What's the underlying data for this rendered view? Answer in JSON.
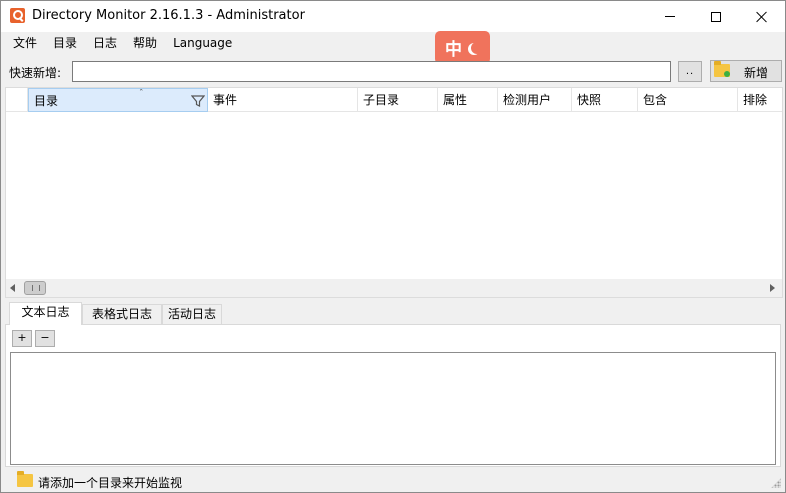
{
  "window": {
    "title": "Directory Monitor 2.16.1.3 - Administrator"
  },
  "menu": {
    "items": [
      "文件",
      "目录",
      "日志",
      "帮助",
      "Language"
    ]
  },
  "ime": {
    "mode_char": "中"
  },
  "quick_add": {
    "label": "快速新增:",
    "input_value": "",
    "browse_label": "..",
    "new_label": "新增"
  },
  "grid": {
    "columns": [
      "目录",
      "事件",
      "子目录",
      "属性",
      "检测用户",
      "快照",
      "包含",
      "排除"
    ],
    "rows": []
  },
  "log": {
    "tabs": [
      "文本日志",
      "表格式日志",
      "活动日志"
    ],
    "active_tab": "文本日志",
    "plus_label": "+",
    "minus_label": "−"
  },
  "status": {
    "text": "请添加一个目录来开始监视"
  }
}
